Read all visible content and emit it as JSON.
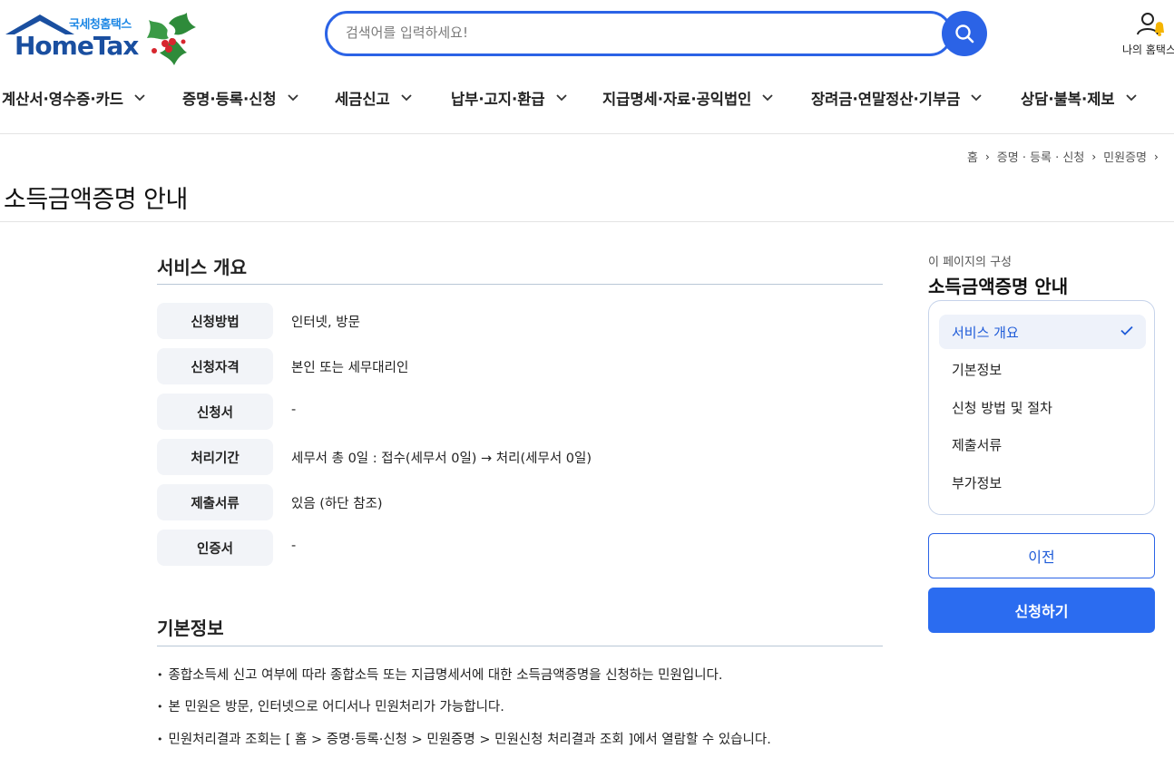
{
  "header": {
    "logo_sub": "국세청홈택스",
    "logo_main": "HomeTax",
    "search_placeholder": "검색어를 입력하세요!",
    "my_home_label": "나의 홈택스"
  },
  "gnb": [
    {
      "label": "계산서·영수증·카드"
    },
    {
      "label": "증명·등록·신청"
    },
    {
      "label": "세금신고"
    },
    {
      "label": "납부·고지·환급"
    },
    {
      "label": "지급명세·자료·공익법인"
    },
    {
      "label": "장려금·연말정산·기부금"
    },
    {
      "label": "상담·불복·제보"
    }
  ],
  "breadcrumb": [
    "홈",
    "증명 · 등록 · 신청",
    "민원증명"
  ],
  "page_title": "소득금액증명 안내",
  "overview": {
    "title": "서비스 개요",
    "rows": [
      {
        "label": "신청방법",
        "value": "인터넷, 방문"
      },
      {
        "label": "신청자격",
        "value": "본인 또는 세무대리인"
      },
      {
        "label": "신청서",
        "value": "-"
      },
      {
        "label": "처리기간",
        "value": "세무서 총 0일 : 접수(세무서 0일) → 처리(세무서 0일)"
      },
      {
        "label": "제출서류",
        "value": "있음 (하단 참조)"
      },
      {
        "label": "인증서",
        "value": "-"
      }
    ]
  },
  "basic_info": {
    "title": "기본정보",
    "bullets": [
      "종합소득세 신고 여부에 따라 종합소득 또는 지급명세서에 대한 소득금액증명을 신청하는 민원입니다.",
      "본 민원은 방문, 인터넷으로 어디서나 민원처리가 가능합니다.",
      "민원처리결과 조회는 [ 홈 > 증명·등록·신청 > 민원증명 > 민원신청 처리결과 조회 ]에서 열람할 수 있습니다."
    ]
  },
  "toc": {
    "caption": "이 페이지의 구성",
    "title": "소득금액증명 안내",
    "items": [
      {
        "label": "서비스 개요",
        "active": true
      },
      {
        "label": "기본정보",
        "active": false
      },
      {
        "label": "신청 방법 및 절차",
        "active": false
      },
      {
        "label": "제출서류",
        "active": false
      },
      {
        "label": "부가정보",
        "active": false
      }
    ]
  },
  "buttons": {
    "prev": "이전",
    "apply": "신청하기"
  },
  "colors": {
    "primary": "#2b63e6",
    "active_bg": "#eef2fa"
  }
}
